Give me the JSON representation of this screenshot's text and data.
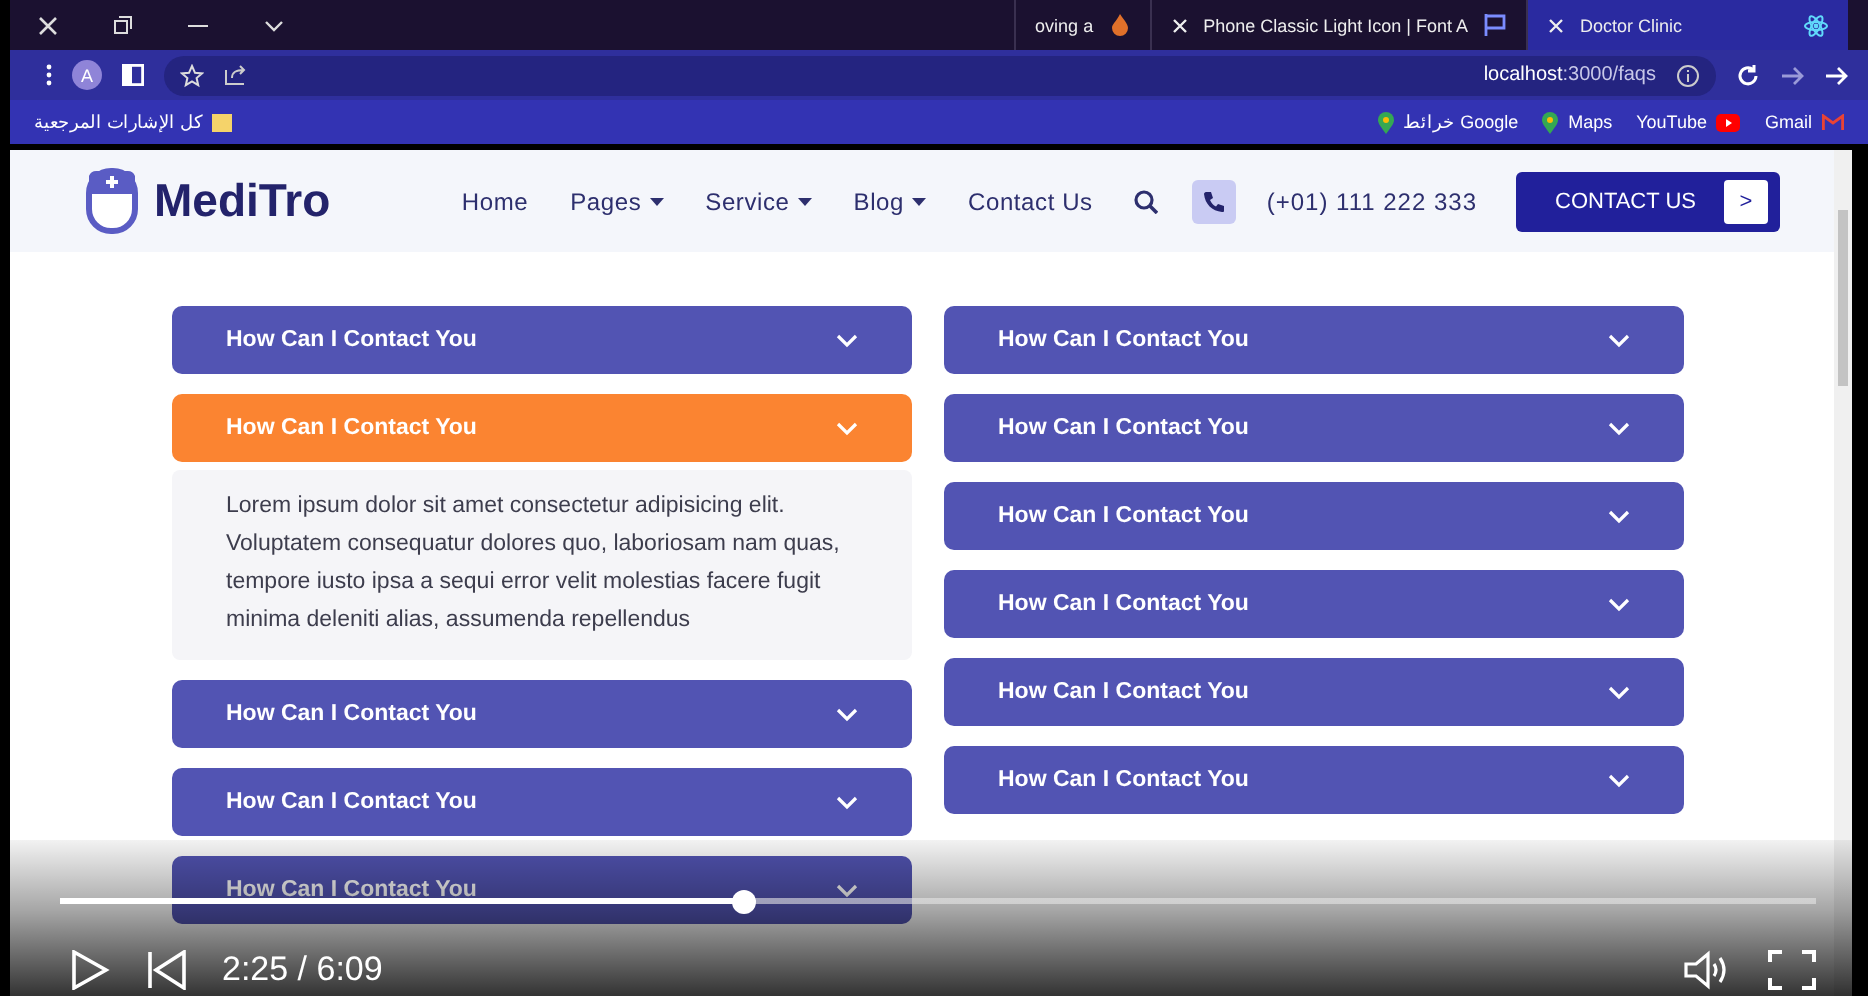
{
  "browser": {
    "tabs": [
      {
        "title": "oving a",
        "selected": false
      },
      {
        "title": "Phone Classic Light Icon | Font A",
        "selected": false
      },
      {
        "title": "Doctor Clinic",
        "selected": true
      }
    ],
    "profile_initial": "A",
    "address": {
      "host": "localhost",
      "path": ":3000/faqs"
    },
    "bookmark_folder": "كل الإشارات المرجعية",
    "bookmarks": [
      {
        "label": "خرائط Google"
      },
      {
        "label": "Maps"
      },
      {
        "label": "YouTube"
      },
      {
        "label": "Gmail"
      }
    ]
  },
  "site": {
    "logo": "MediTro",
    "nav": [
      {
        "label": "Home",
        "dropdown": false
      },
      {
        "label": "Pages",
        "dropdown": true
      },
      {
        "label": "Service",
        "dropdown": true
      },
      {
        "label": "Blog",
        "dropdown": true
      },
      {
        "label": "Contact Us",
        "dropdown": false
      }
    ],
    "phone": "(+01) 111 222 333",
    "cta": "CONTACT US",
    "cta_arrow": ">"
  },
  "faq": {
    "columns": [
      [
        {
          "question": "How Can I Contact You",
          "expanded": false
        },
        {
          "question": "How Can I Contact You",
          "expanded": true,
          "answer": "Lorem ipsum dolor sit amet consectetur adipisicing elit. Voluptatem consequatur dolores quo, laboriosam nam quas, tempore iusto ipsa a sequi error velit molestias facere fugit minima deleniti alias, assumenda repellendus"
        },
        {
          "question": "How Can I Contact You",
          "expanded": false
        },
        {
          "question": "How Can I Contact You",
          "expanded": false
        },
        {
          "question": "How Can I Contact You",
          "expanded": false
        }
      ],
      [
        {
          "question": "How Can I Contact You",
          "expanded": false
        },
        {
          "question": "How Can I Contact You",
          "expanded": false
        },
        {
          "question": "How Can I Contact You",
          "expanded": false
        },
        {
          "question": "How Can I Contact You",
          "expanded": false
        },
        {
          "question": "How Can I Contact You",
          "expanded": false
        },
        {
          "question": "How Can I Contact You",
          "expanded": false
        }
      ]
    ]
  },
  "player": {
    "level": 0.39,
    "time": "2:25 / 6:09"
  }
}
